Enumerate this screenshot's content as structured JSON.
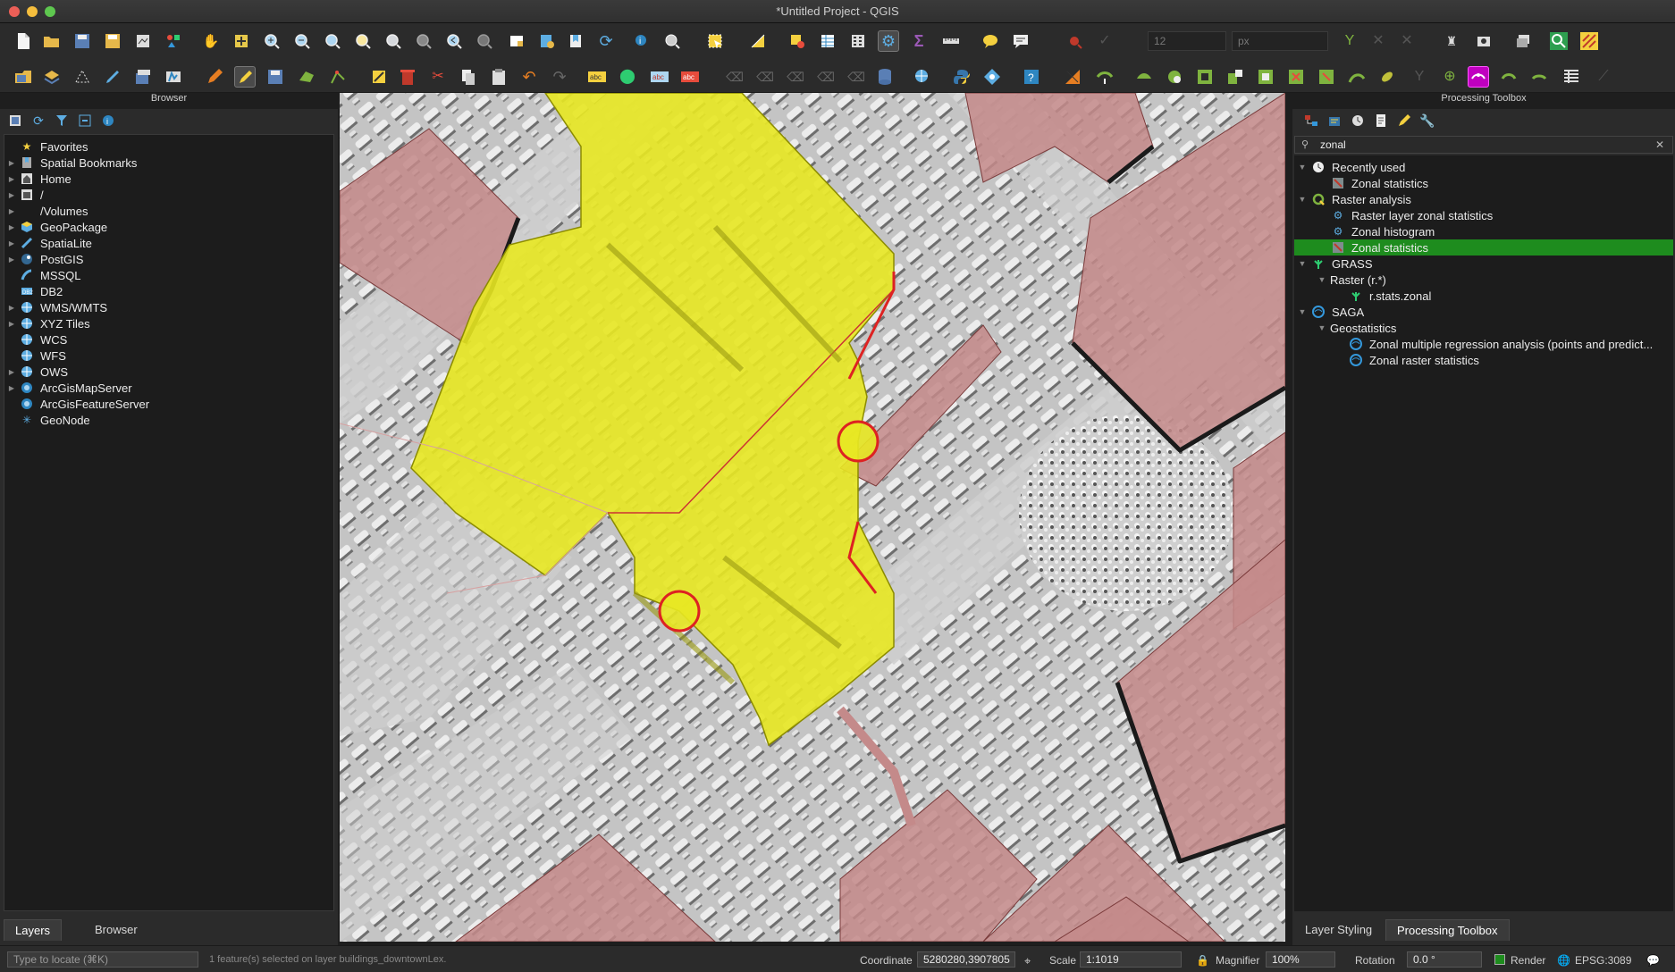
{
  "window": {
    "title": "*Untitled Project - QGIS"
  },
  "toolbar": {
    "font_size_value": "12",
    "font_unit_value": "px",
    "icons_row1": [
      "new-project-icon",
      "open-project-icon",
      "save-project-icon",
      "save-as-icon",
      "print-layout-icon",
      "style-manager-icon",
      "pan-icon",
      "pan-to-selection-icon",
      "zoom-in-icon",
      "zoom-out-icon",
      "zoom-full-icon",
      "zoom-to-selection-icon",
      "zoom-to-layer-icon",
      "zoom-native-icon",
      "zoom-last-icon",
      "zoom-next-icon",
      "new-map-view-icon",
      "new-bookmark-icon",
      "show-bookmarks-icon",
      "refresh-icon",
      "identify-icon",
      "action-icon",
      "select-features-icon",
      "select-by-value-icon",
      "deselect-icon",
      "attribute-table-icon",
      "field-calculator-icon",
      "processing-toolbox-icon",
      "statistics-icon",
      "measure-icon",
      "map-tips-icon",
      "annotation-icon",
      "pin-icon",
      "label-icon"
    ],
    "icons_row2": [
      "current-edits-icon",
      "add-layer-icon",
      "digitize-icon",
      "toggle-editing-icon",
      "save-edits-icon",
      "add-feature-icon",
      "vertex-tool-icon",
      "delete-icon",
      "cut-icon",
      "copy-icon",
      "paste-icon",
      "undo-icon",
      "redo-icon",
      "label-tool-icon",
      "python-icon",
      "plugin-icon",
      "help-icon"
    ]
  },
  "browser": {
    "header": "Browser",
    "items": [
      {
        "label": "Favorites",
        "icon": "star-icon",
        "expandable": false
      },
      {
        "label": "Spatial Bookmarks",
        "icon": "bookmark-icon",
        "expandable": true
      },
      {
        "label": "Home",
        "icon": "home-icon",
        "expandable": true
      },
      {
        "label": "/",
        "icon": "folder-icon",
        "expandable": true
      },
      {
        "label": "/Volumes",
        "icon": "folder-icon",
        "expandable": true
      },
      {
        "label": "GeoPackage",
        "icon": "geopackage-icon",
        "expandable": true
      },
      {
        "label": "SpatiaLite",
        "icon": "spatialite-icon",
        "expandable": true
      },
      {
        "label": "PostGIS",
        "icon": "postgis-icon",
        "expandable": true
      },
      {
        "label": "MSSQL",
        "icon": "mssql-icon",
        "expandable": false
      },
      {
        "label": "DB2",
        "icon": "db2-icon",
        "expandable": false
      },
      {
        "label": "WMS/WMTS",
        "icon": "globe-icon",
        "expandable": true
      },
      {
        "label": "XYZ Tiles",
        "icon": "globe-icon",
        "expandable": true
      },
      {
        "label": "WCS",
        "icon": "globe-icon",
        "expandable": false
      },
      {
        "label": "WFS",
        "icon": "globe-icon",
        "expandable": false
      },
      {
        "label": "OWS",
        "icon": "globe-icon",
        "expandable": true
      },
      {
        "label": "ArcGisMapServer",
        "icon": "arcgis-icon",
        "expandable": true
      },
      {
        "label": "ArcGisFeatureServer",
        "icon": "arcgis-icon",
        "expandable": false
      },
      {
        "label": "GeoNode",
        "icon": "geonode-icon",
        "expandable": false
      }
    ],
    "tabs": [
      "Layers",
      "Browser"
    ]
  },
  "toolbox": {
    "header": "Processing Toolbox",
    "search_value": "zonal",
    "tree": [
      {
        "label": "Recently used",
        "level": 0,
        "expanded": true,
        "icon": "clock-icon"
      },
      {
        "label": "Zonal statistics",
        "level": 1,
        "icon": "zonal-icon"
      },
      {
        "label": "Raster analysis",
        "level": 0,
        "expanded": true,
        "icon": "qgis-icon"
      },
      {
        "label": "Raster layer zonal statistics",
        "level": 1,
        "icon": "gear-icon"
      },
      {
        "label": "Zonal histogram",
        "level": 1,
        "icon": "gear-icon"
      },
      {
        "label": "Zonal statistics",
        "level": 1,
        "icon": "zonal-icon",
        "selected": true
      },
      {
        "label": "GRASS",
        "level": 0,
        "expanded": true,
        "icon": "grass-icon"
      },
      {
        "label": "Raster (r.*)",
        "level": 1,
        "expanded": true,
        "icon": ""
      },
      {
        "label": "r.stats.zonal",
        "level": 2,
        "icon": "grass-icon"
      },
      {
        "label": "SAGA",
        "level": 0,
        "expanded": true,
        "icon": "saga-icon"
      },
      {
        "label": "Geostatistics",
        "level": 1,
        "expanded": true,
        "icon": ""
      },
      {
        "label": "Zonal multiple regression analysis (points and predict...",
        "level": 2,
        "icon": "saga-icon"
      },
      {
        "label": "Zonal raster statistics",
        "level": 2,
        "icon": "saga-icon"
      }
    ],
    "tabs": [
      "Layer Styling",
      "Processing Toolbox"
    ]
  },
  "statusbar": {
    "locate_placeholder": "Type to locate (⌘K)",
    "message": "1 feature(s) selected on layer buildings_downtownLex.",
    "coordinate_label": "Coordinate",
    "coordinate_value": "5280280,3907805",
    "scale_label": "Scale",
    "scale_value": "1:1019",
    "magnifier_label": "Magnifier",
    "magnifier_value": "100%",
    "rotation_label": "Rotation",
    "rotation_value": "0.0 °",
    "render_label": "Render",
    "crs_value": "EPSG:3089"
  },
  "colors": {
    "selection_yellow": "#e8e822",
    "building_red": "#c48a8a",
    "selected_tool_green": "#1e8c1e",
    "active_tool_magenta": "#c000c0"
  }
}
